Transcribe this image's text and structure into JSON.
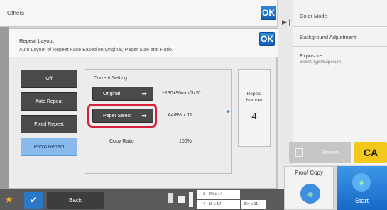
{
  "background": {
    "title": "Others",
    "ok_label": "OK",
    "right_panel": {
      "color_mode": "Color Mode",
      "background_adjustment": "Background Adjustment",
      "exposure": "Exposure",
      "exposure_sub": "Select Type/Exposure"
    },
    "preview_label": "Preview",
    "ca_label": "CA",
    "proof_copy_label": "Proof Copy",
    "start_label": "Start",
    "back_label": "Back",
    "tray_sizes": [
      "8½ x 14",
      "11 x 17",
      "8½ x 11"
    ],
    "tray_numbers": [
      "3",
      "4"
    ]
  },
  "dialog": {
    "title": "Repeat Layout",
    "description": "Auto Layout of Repeat Face Based on Original, Paper Size and Ratio.",
    "ok_label": "OK",
    "modes": [
      "Off",
      "Auto Repeat",
      "Fixed Repeat",
      "Photo Repeat"
    ],
    "selected_mode": "Photo Repeat",
    "current_setting_label": "Current Setting",
    "original_label": "Original",
    "original_value": "~130x90mm/3x5\"",
    "paper_select_label": "Paper Select",
    "paper_value": "A4/8½ x 11",
    "copy_ratio_label": "Copy Ratio",
    "copy_ratio_value": "100%",
    "repeat_number_label": "Repeat Number",
    "repeat_number_value": "4"
  },
  "colors": {
    "accent_blue": "#1f6fc8",
    "highlight_red": "#d8203a",
    "ca_yellow": "#f2c81b",
    "selected_mode": "#88baec"
  }
}
